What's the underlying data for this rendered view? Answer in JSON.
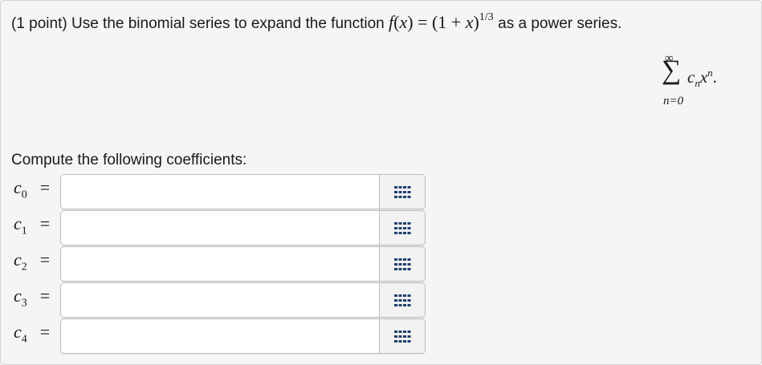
{
  "problem": {
    "points_text": "(1 point) Use the binomial series to expand the function",
    "function_parts": {
      "f": "f",
      "open_x": "(",
      "x1": "x",
      "close_eq": ") = (1 + ",
      "x2": "x",
      "close": ")",
      "exponent": "1/3"
    },
    "as_text": " as a power series.",
    "sum": {
      "upper": "∞",
      "sigma": "∑",
      "coef": "c",
      "coef_sub": "n",
      "var": "x",
      "var_sup": "n",
      "period": ".",
      "lower": "n=0"
    },
    "instructions": "Compute the following coefficients:"
  },
  "rows": [
    {
      "var": "c",
      "sub": "0",
      "eq": "=",
      "value": "",
      "placeholder": ""
    },
    {
      "var": "c",
      "sub": "1",
      "eq": "=",
      "value": "",
      "placeholder": ""
    },
    {
      "var": "c",
      "sub": "2",
      "eq": "=",
      "value": "",
      "placeholder": ""
    },
    {
      "var": "c",
      "sub": "3",
      "eq": "=",
      "value": "",
      "placeholder": ""
    },
    {
      "var": "c",
      "sub": "4",
      "eq": "=",
      "value": "",
      "placeholder": ""
    }
  ],
  "icons": {
    "palette": "equation-palette-icon"
  },
  "colors": {
    "panel_bg": "#f5f5f5",
    "panel_border": "#d4d4d4",
    "input_border": "#bdbdbd",
    "text": "#1a1a1a",
    "icon": "#1f3f6e"
  }
}
